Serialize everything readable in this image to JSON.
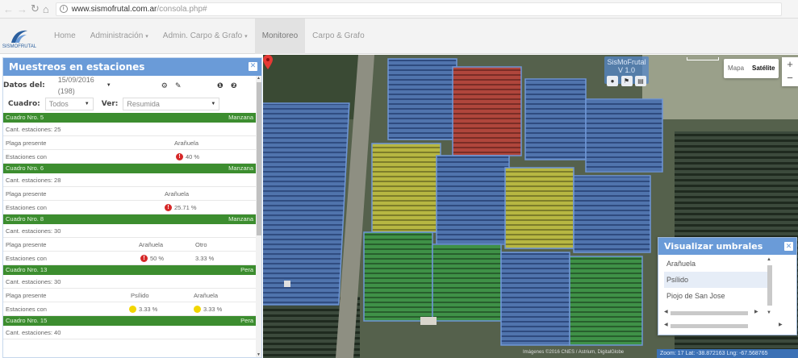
{
  "browser": {
    "url_host": "www.sismofrutal.com.ar",
    "url_path": "/consola.php#"
  },
  "navbar": {
    "logo_text": "SISMOFRUTAL",
    "items": [
      {
        "label": "Home",
        "caret": false,
        "active": false
      },
      {
        "label": "Administración",
        "caret": true,
        "active": false
      },
      {
        "label": "Admin. Carpo & Grafo",
        "caret": true,
        "active": false
      },
      {
        "label": "Monitoreo",
        "caret": false,
        "active": true
      },
      {
        "label": "Carpo & Grafo",
        "caret": false,
        "active": false
      }
    ]
  },
  "panel": {
    "title": "Muestreos en estaciones",
    "datos_label": "Datos del:",
    "datos_value": "15/09/2016 (198)",
    "cuadro_label": "Cuadro:",
    "cuadro_value": "Todos",
    "ver_label": "Ver:",
    "ver_value": "Resumida",
    "cuadros": [
      {
        "name": "Cuadro Nro. 5",
        "crop": "Manzana",
        "cant": "Cant. estaciones: 25",
        "plaga_label": "Plaga presente",
        "plagas": [
          "Arañuela"
        ],
        "estaciones_label": "Estaciones con",
        "values": [
          {
            "icon": "red",
            "text": "40 %"
          }
        ]
      },
      {
        "name": "Cuadro Nro. 6",
        "crop": "Manzana",
        "cant": "Cant. estaciones: 28",
        "plaga_label": "Plaga presente",
        "plagas": [
          "Arañuela"
        ],
        "estaciones_label": "Estaciones con",
        "values": [
          {
            "icon": "red",
            "text": "25.71 %"
          }
        ]
      },
      {
        "name": "Cuadro Nro. 8",
        "crop": "Manzana",
        "cant": "Cant. estaciones: 30",
        "plaga_label": "Plaga presente",
        "plagas": [
          "Arañuela",
          "Otro"
        ],
        "estaciones_label": "Estaciones con",
        "values": [
          {
            "icon": "red",
            "text": "50 %"
          },
          {
            "icon": "",
            "text": "3.33 %"
          }
        ]
      },
      {
        "name": "Cuadro Nro. 13",
        "crop": "Pera",
        "cant": "Cant. estaciones: 30",
        "plaga_label": "Plaga presente",
        "plagas": [
          "Psílido",
          "Arañuela"
        ],
        "estaciones_label": "Estaciones con",
        "values": [
          {
            "icon": "yellow",
            "text": "3.33 %"
          },
          {
            "icon": "yellow",
            "text": "3.33 %"
          }
        ]
      },
      {
        "name": "Cuadro Nro. 15",
        "crop": "Pera",
        "cant": "Cant. estaciones: 40"
      }
    ]
  },
  "map": {
    "version_label": "SisMoFrutal V 1.0",
    "map_type_options": [
      "Mapa",
      "Satélite"
    ],
    "map_type_selected": "Satélite",
    "zoom_in": "+",
    "zoom_out": "−",
    "google_credit": "Imágenes ©2016 CNES / Astrium, DigitalGlobe",
    "status": "Zoom: 17   Lat: -38.872163  Lng: -67.568765"
  },
  "umbrales": {
    "title": "Visualizar umbrales",
    "options": [
      "Arañuela",
      "Psílido",
      "Piojo de San Jose"
    ],
    "selected": "Psílido"
  },
  "colors": {
    "accent_blue": "#6a9bd8",
    "row_green": "#3c8d2f",
    "alert_red": "#d62828",
    "alert_yellow": "#f2d600"
  }
}
